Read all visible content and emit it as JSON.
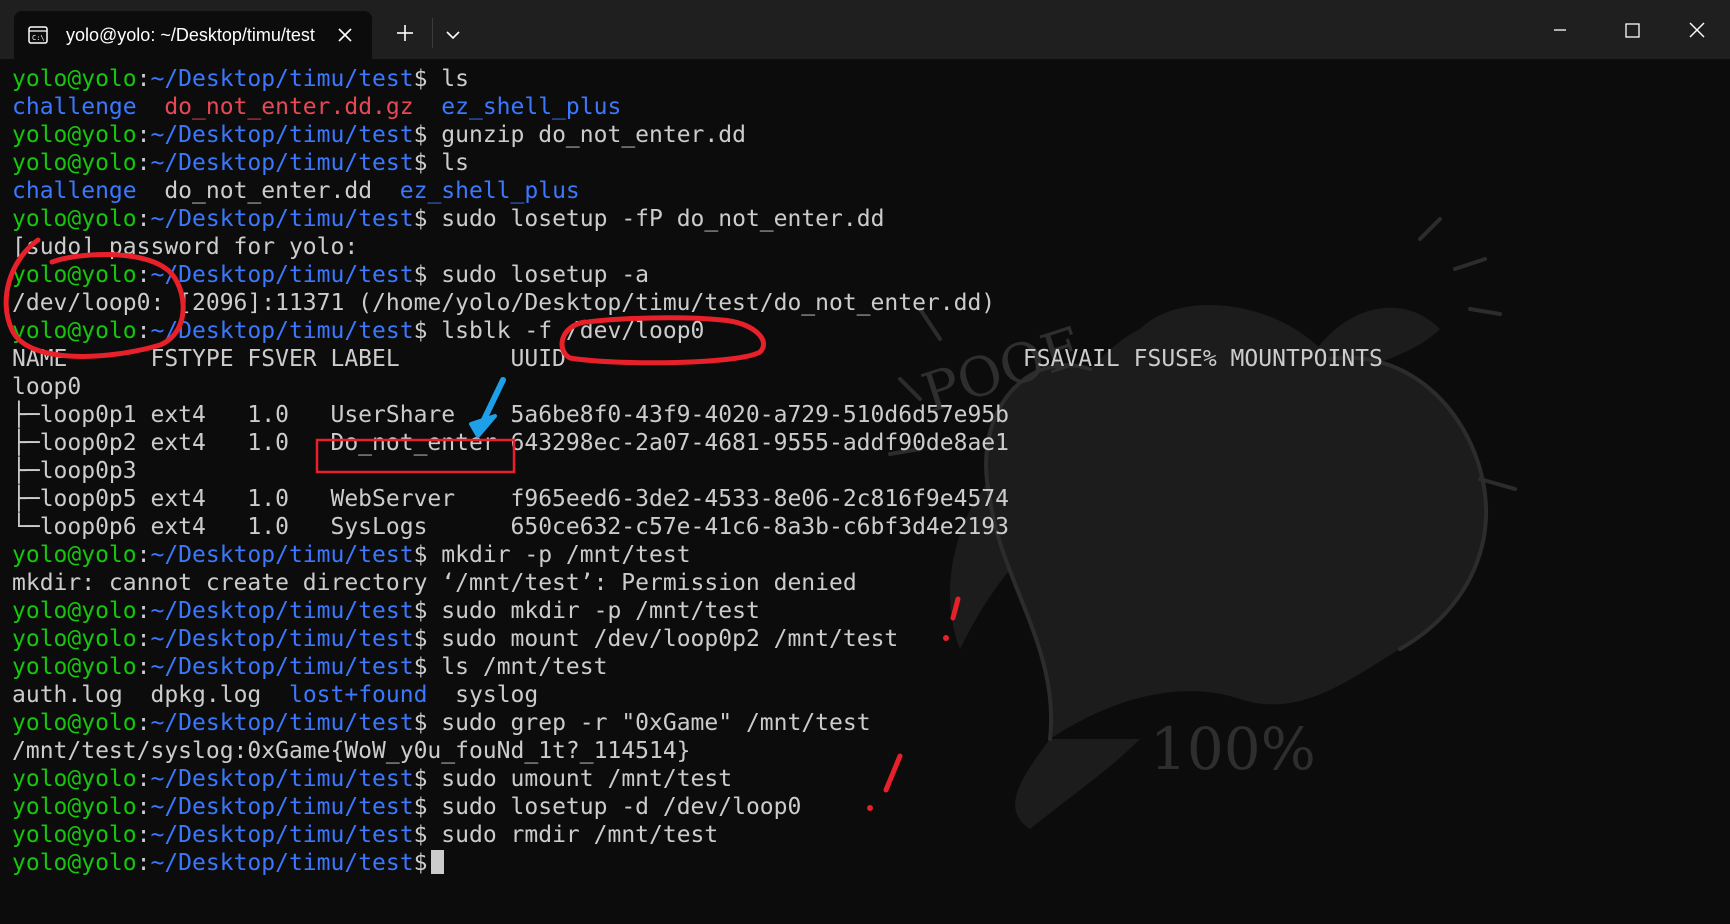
{
  "window": {
    "tab_title": "yolo@yolo: ~/Desktop/timu/test",
    "tab_icon": "terminal-icon",
    "new_tab_symbol": "+",
    "dropdown_icon": "chevron-down-icon",
    "controls": [
      "minimize-icon",
      "maximize-icon",
      "close-icon"
    ]
  },
  "colors": {
    "background": "#0c0c0c",
    "titlebar": "#1f1f1f",
    "text": "#cccccc",
    "user_host": "#16c60c",
    "path": "#3b78ff",
    "directory": "#3b78ff",
    "archive": "#e74856",
    "annotation_red": "#e8202a",
    "annotation_blue": "#1ea0e8"
  },
  "prompt": {
    "user_host": "yolo@yolo",
    "colon": ":",
    "path": "~/Desktop/timu/test",
    "symbol": "$"
  },
  "terminal": {
    "cmd_ls_1": " ls",
    "ls1": {
      "a": "challenge",
      "sep1": "  ",
      "b": "do_not_enter.dd.gz",
      "sep2": "  ",
      "c": "ez_shell_plus"
    },
    "cmd_gunzip": " gunzip do_not_enter.dd",
    "cmd_ls_2": " ls",
    "ls2": {
      "a": "challenge",
      "sep1": "  ",
      "b": "do_not_enter.dd",
      "sep2": "  ",
      "c": "ez_shell_plus"
    },
    "cmd_losetup_fp": " sudo losetup -fP do_not_enter.dd",
    "sudo_password": "[sudo] password for yolo:",
    "cmd_losetup_a": " sudo losetup -a",
    "loop_info": "/dev/loop0: [2096]:11371 (/home/yolo/Desktop/timu/test/do_not_enter.dd)",
    "cmd_lsblk": " lsblk -f /dev/loop0",
    "lsblk_header": "NAME      FSTYPE FSVER LABEL        UUID                                 FSAVAIL FSUSE% MOUNTPOINTS",
    "lsblk_rows": [
      "loop0",
      "├─loop0p1 ext4   1.0   UserShare    5a6be8f0-43f9-4020-a729-510d6d57e95b",
      "├─loop0p2 ext4   1.0   Do_not_enter 643298ec-2a07-4681-9555-addf90de8ae1",
      "├─loop0p3",
      "├─loop0p5 ext4   1.0   WebServer    f965eed6-3de2-4533-8e06-2c816f9e4574",
      "└─loop0p6 ext4   1.0   SysLogs      650ce632-c57e-41c6-8a3b-c6bf3d4e2193"
    ],
    "cmd_mkdir": " mkdir -p /mnt/test",
    "mkdir_error": "mkdir: cannot create directory ‘/mnt/test’: Permission denied",
    "cmd_sudo_mkdir": " sudo mkdir -p /mnt/test",
    "cmd_mount": " sudo mount /dev/loop0p2 /mnt/test",
    "cmd_ls_mnt": " ls /mnt/test",
    "ls3": {
      "a": "auth.log",
      "sep1": "  ",
      "b": "dpkg.log",
      "sep2": "  ",
      "c": "lost+found",
      "sep3": "  ",
      "d": "syslog"
    },
    "cmd_grep": " sudo grep -r \"0xGame\" /mnt/test",
    "grep_result": "/mnt/test/syslog:0xGame{WoW_y0u_fouNd_1t?_114514}",
    "cmd_umount": " sudo umount /mnt/test",
    "cmd_losetup_d": " sudo losetup -d /dev/loop0",
    "cmd_rmdir": " sudo rmdir /mnt/test"
  },
  "artwork": {
    "text_poof": "POOF",
    "text_percent": "100%"
  }
}
